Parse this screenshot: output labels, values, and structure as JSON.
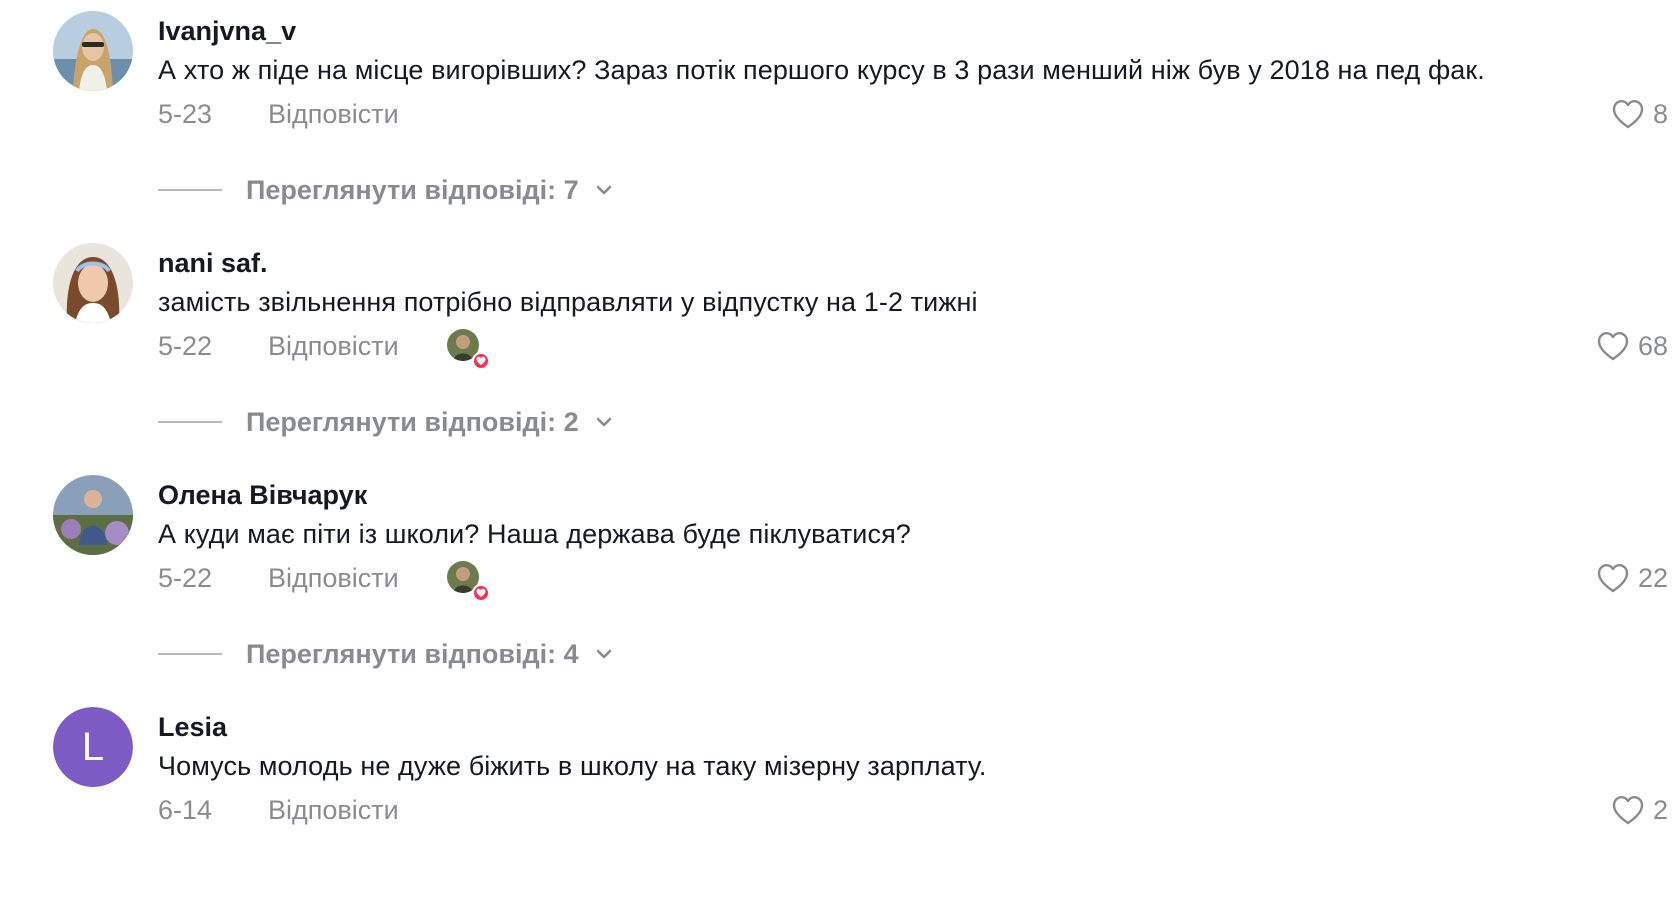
{
  "comments": [
    {
      "username": "Ivanjvna_v",
      "text": "А хто ж піде на місце вигорівших? Зараз потік першого курсу в 3 рази менший ніж був у 2018 на пед фак.",
      "date": "5-23",
      "reply_label": "Відповісти",
      "likes": "8",
      "creator_liked": false,
      "view_replies": "Переглянути відповіді: 7"
    },
    {
      "username": "nani saf.",
      "text": "замість звільнення потрібно відправляти у відпустку на 1-2 тижні",
      "date": "5-22",
      "reply_label": "Відповісти",
      "likes": "68",
      "creator_liked": true,
      "view_replies": "Переглянути відповіді: 2"
    },
    {
      "username": "Олена Вівчарук",
      "text": "А куди має піти із школи? Наша держава буде піклуватися?",
      "date": "5-22",
      "reply_label": "Відповісти",
      "likes": "22",
      "creator_liked": true,
      "view_replies": "Переглянути відповіді: 4"
    },
    {
      "username": "Lesia",
      "avatar_letter": "L",
      "text": "Чомусь молодь не дуже біжить в школу на таку мізерну зарплату.",
      "date": "6-14",
      "reply_label": "Відповісти",
      "likes": "2",
      "creator_liked": false
    }
  ],
  "icons": {
    "like": "heart-outline-icon",
    "expand": "chevron-down-icon",
    "creator_like_badge": "heart-filled-icon"
  },
  "colors": {
    "text_primary": "#161823",
    "text_secondary": "#8a8b91",
    "creator_heart": "#fe2c55",
    "letter_avatar_bg": "#7d5bc5"
  }
}
